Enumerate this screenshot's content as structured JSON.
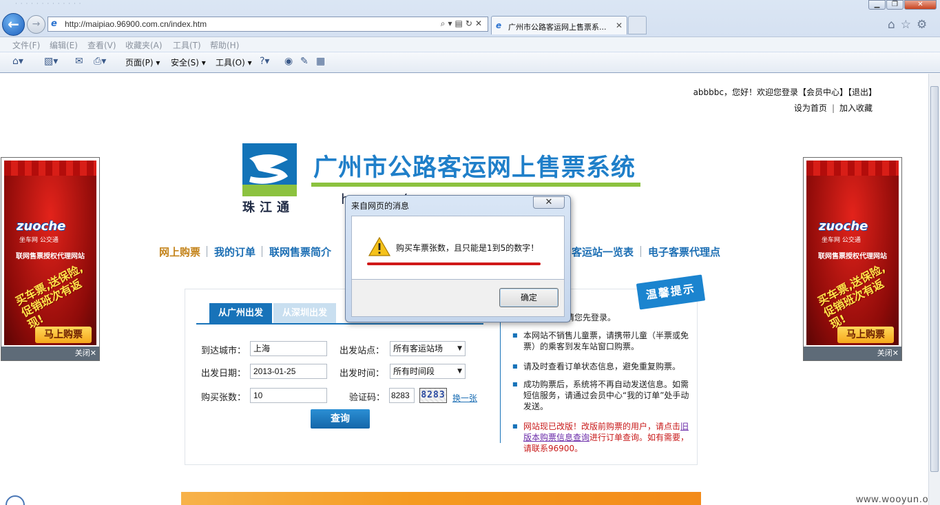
{
  "browser": {
    "url": "http://maipiao.96900.com.cn/index.htm",
    "tab_title": "广州市公路客运网上售票系...",
    "menu": [
      "文件(F)",
      "编辑(E)",
      "查看(V)",
      "收藏夹(A)",
      "工具(T)",
      "帮助(H)"
    ],
    "commands": {
      "page": "页面(P)",
      "safety": "安全(S)",
      "tools": "工具(O)"
    },
    "window_buttons": {
      "min": "▁",
      "max": "❐",
      "close": "✕"
    }
  },
  "header": {
    "user_line": "abbbbc，您好！欢迎您登录【会员中心】【退出】",
    "set_home": "设为首页",
    "add_fav": "加入收藏"
  },
  "logo": {
    "brand": "珠江通",
    "title": "广州市公路客运网上售票系统",
    "url_partial": "h                              .cn/"
  },
  "nav": {
    "items": [
      "网上购票",
      "我的订单",
      "联网售票简介",
      "客运站一览表",
      "电子客票代理点"
    ]
  },
  "ad": {
    "brand": "zuoche",
    "sub": "坐车网  公交通",
    "line": "联网售票授权代理网站",
    "promo": "买车票,送保险,促销班次有返现!",
    "buy": "马上购票",
    "close": "关闭✕"
  },
  "form": {
    "tabs": [
      "从广州出发",
      "从深圳出发"
    ],
    "dest_city_label": "到达城市：",
    "dest_city_value": "上海",
    "depart_station_label": "出发站点：",
    "depart_station_value": "所有客运站场",
    "depart_date_label": "出发日期：",
    "depart_date_value": "2013-01-25",
    "depart_time_label": "出发时间：",
    "depart_time_value": "所有时间段",
    "qty_label": "购买张数：",
    "qty_value": "10",
    "captcha_label": "验证码：",
    "captcha_value": "8283",
    "captcha_image_text": "8283",
    "refresh_captcha": "换一张",
    "query_button": "查询"
  },
  "tips": {
    "badge": "温馨提示",
    "first": "请您先登录。",
    "items": [
      "本网站不销售儿童票，请携带儿童（半票或免票）的乘客到发车站窗口购票。",
      "请及时查看订单状态信息，避免重复购票。",
      "成功购票后，系统将不再自动发送信息。如需短信服务，请通过会员中心“我的订单”处手动发送。"
    ],
    "red_prefix": "网站现已改版！改版前购票的用户，请点击",
    "red_link": "旧版本购票信息查询",
    "red_suffix": "进行订单查询。如有需要，请联系96900。"
  },
  "dialog": {
    "title": "来自网页的消息",
    "message": "购买车票张数，且只能是1到5的数字！",
    "ok": "确定",
    "close": "✕"
  },
  "watermark": "www.wooyun.org"
}
